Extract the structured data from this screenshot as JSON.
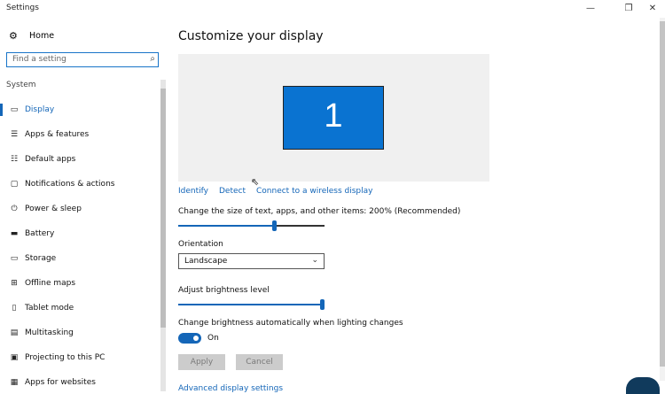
{
  "window": {
    "title": "Settings",
    "minimize": "—",
    "restore": "❐",
    "close": "✕"
  },
  "sidebar": {
    "home_label": "Home",
    "search_placeholder": "Find a setting",
    "section_label": "System",
    "items": [
      {
        "label": "Display",
        "icon": "display-icon",
        "active": true
      },
      {
        "label": "Apps & features",
        "icon": "apps-features-icon"
      },
      {
        "label": "Default apps",
        "icon": "default-apps-icon"
      },
      {
        "label": "Notifications & actions",
        "icon": "notifications-icon"
      },
      {
        "label": "Power & sleep",
        "icon": "power-icon"
      },
      {
        "label": "Battery",
        "icon": "battery-icon"
      },
      {
        "label": "Storage",
        "icon": "storage-icon"
      },
      {
        "label": "Offline maps",
        "icon": "map-icon"
      },
      {
        "label": "Tablet mode",
        "icon": "tablet-icon"
      },
      {
        "label": "Multitasking",
        "icon": "multitasking-icon"
      },
      {
        "label": "Projecting to this PC",
        "icon": "projecting-icon"
      },
      {
        "label": "Apps for websites",
        "icon": "apps-websites-icon"
      }
    ]
  },
  "main": {
    "title": "Customize your display",
    "monitor_number": "1",
    "links": {
      "identify": "Identify",
      "detect": "Detect",
      "connect": "Connect to a wireless display"
    },
    "scale_label": "Change the size of text, apps, and other items: 200% (Recommended)",
    "scale_slider_value": 0.66,
    "orientation_label": "Orientation",
    "orientation_value": "Landscape",
    "brightness_label": "Adjust brightness level",
    "brightness_slider_value": 1.0,
    "auto_brightness_label": "Change brightness automatically when lighting changes",
    "auto_brightness_state": "On",
    "apply_label": "Apply",
    "cancel_label": "Cancel",
    "advanced_link": "Advanced display settings"
  },
  "colors": {
    "accent": "#1466b8",
    "monitor": "#0a73d1",
    "preview_bg": "#f0f0f0"
  }
}
